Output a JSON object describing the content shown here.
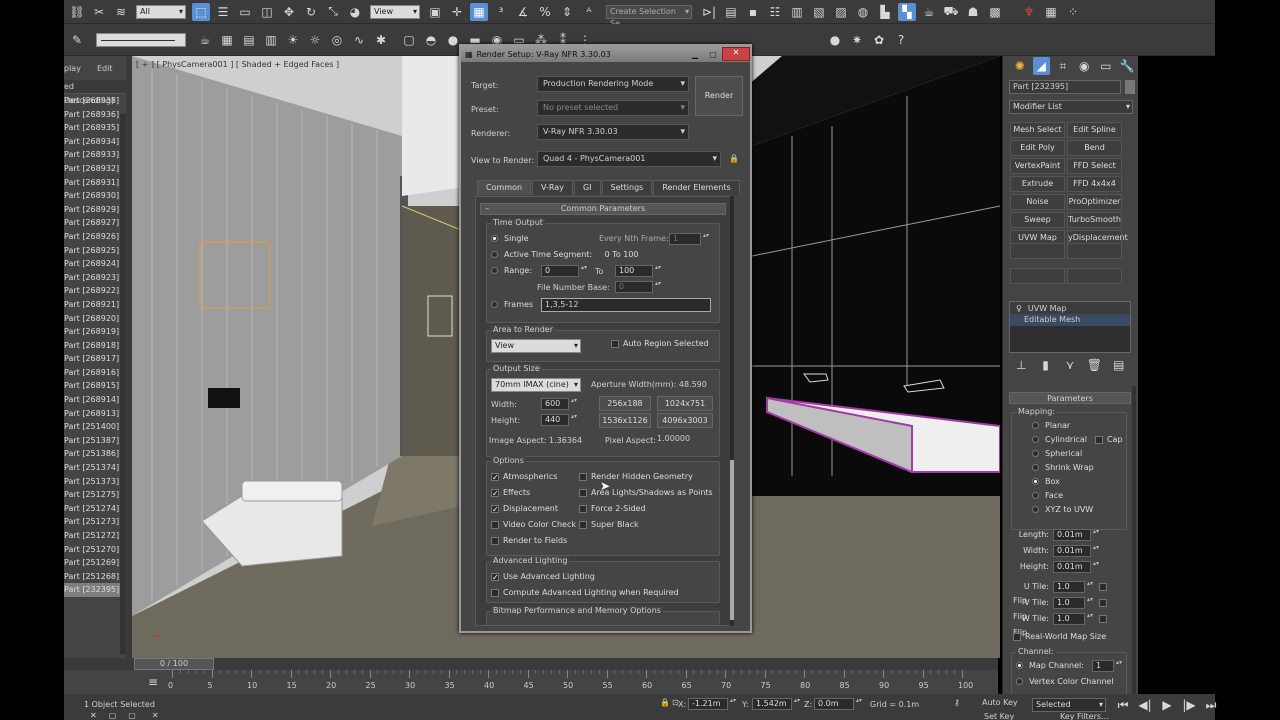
{
  "toolbar": {
    "filter_value": "All",
    "view_value": "View",
    "selection_set_placeholder": "Create Selection Se"
  },
  "scene_panel": {
    "menu": [
      "play",
      "Edit"
    ],
    "sort_label": "ed Descending)",
    "items": [
      "Part [268938]",
      "Part [268936]",
      "Part [268935]",
      "Part [268934]",
      "Part [268933]",
      "Part [268932]",
      "Part [268931]",
      "Part [268930]",
      "Part [268929]",
      "Part [268927]",
      "Part [268926]",
      "Part [268925]",
      "Part [268924]",
      "Part [268923]",
      "Part [268922]",
      "Part [268921]",
      "Part [268920]",
      "Part [268919]",
      "Part [268918]",
      "Part [268917]",
      "Part [268916]",
      "Part [268915]",
      "Part [268914]",
      "Part [268913]",
      "Part [251400]",
      "Part [251387]",
      "Part [251386]",
      "Part [251374]",
      "Part [251373]",
      "Part [251275]",
      "Part [251274]",
      "Part [251273]",
      "Part [251272]",
      "Part [251270]",
      "Part [251269]",
      "Part [251268]",
      "Part [232395]"
    ]
  },
  "viewport": {
    "label": "[ + ] [ PhysCamera001 ] [ Shaded + Edged Faces ]"
  },
  "render_setup": {
    "title": "Render Setup: V-Ray NFR 3.30.03",
    "target_label": "Target:",
    "target_value": "Production Rendering Mode",
    "preset_label": "Preset:",
    "preset_value": "No preset selected",
    "renderer_label": "Renderer:",
    "renderer_value": "V-Ray NFR 3.30.03",
    "render_button": "Render",
    "view_label": "View to Render:",
    "view_value": "Quad 4 - PhysCamera001",
    "tabs": [
      "Common",
      "V-Ray",
      "GI",
      "Settings",
      "Render Elements"
    ],
    "rollout_title": "Common Parameters",
    "time_output": {
      "title": "Time Output",
      "single": "Single",
      "every_nth": "Every Nth Frame:",
      "every_nth_value": "1",
      "active_segment": "Active Time Segment:",
      "active_segment_value": "0 To 100",
      "range": "Range:",
      "range_from": "0",
      "range_to_label": "To",
      "range_to": "100",
      "file_number_base": "File Number Base:",
      "file_number_base_value": "0",
      "frames": "Frames",
      "frames_value": "1,3,5-12"
    },
    "area_to_render": {
      "title": "Area to Render",
      "value": "View",
      "auto_region": "Auto Region Selected"
    },
    "output_size": {
      "title": "Output Size",
      "preset": "70mm IMAX (cine)",
      "aperture": "Aperture Width(mm): 48.590",
      "width_label": "Width:",
      "width_value": "600",
      "height_label": "Height:",
      "height_value": "440",
      "presets": [
        "256x188",
        "1024x751",
        "1536x1126",
        "4096x3003"
      ],
      "image_aspect": "Image Aspect: 1.36364",
      "pixel_aspect_label": "Pixel Aspect:",
      "pixel_aspect_value": "1.00000"
    },
    "options": {
      "title": "Options",
      "left": [
        {
          "label": "Atmospherics",
          "checked": true
        },
        {
          "label": "Effects",
          "checked": true
        },
        {
          "label": "Displacement",
          "checked": true
        },
        {
          "label": "Video Color Check",
          "checked": false
        },
        {
          "label": "Render to Fields",
          "checked": false
        }
      ],
      "right": [
        {
          "label": "Render Hidden Geometry",
          "checked": false
        },
        {
          "label": "Area Lights/Shadows as Points",
          "checked": false
        },
        {
          "label": "Force 2-Sided",
          "checked": false
        },
        {
          "label": "Super Black",
          "checked": false
        }
      ]
    },
    "advanced_lighting": {
      "title": "Advanced Lighting",
      "use": "Use Advanced Lighting",
      "compute": "Compute Advanced Lighting when Required"
    },
    "bitmap_title": "Bitmap Performance and Memory Options"
  },
  "command_panel": {
    "object_name": "Part [232395]",
    "modifier_list": "Modifier List",
    "modifier_buttons": [
      "Mesh Select",
      "Edit Spline",
      "Edit Poly",
      "Bend",
      "VertexPaint",
      "FFD Select",
      "Extrude",
      "FFD 4x4x4",
      "Noise",
      "ProOptimizer",
      "Sweep",
      "TurboSmooth",
      "UVW Map",
      "yDisplacement"
    ],
    "stack": [
      "UVW Map",
      "Editable Mesh"
    ],
    "parameters_title": "Parameters",
    "mapping_title": "Mapping:",
    "mappings": [
      "Planar",
      "Cylindrical",
      "Spherical",
      "Shrink Wrap",
      "Box",
      "Face",
      "XYZ to UVW"
    ],
    "cap_label": "Cap",
    "dimensions": [
      {
        "label": "Length:",
        "value": "0.01m"
      },
      {
        "label": "Width:",
        "value": "0.01m"
      },
      {
        "label": "Height:",
        "value": "0.01m"
      }
    ],
    "tiles": [
      {
        "label": "U Tile:",
        "value": "1.0"
      },
      {
        "label": "V Tile:",
        "value": "1.0"
      },
      {
        "label": "W Tile:",
        "value": "1.0"
      }
    ],
    "flip_label": "Flip",
    "real_world": "Real-World Map Size",
    "channel_title": "Channel:",
    "map_channel_label": "Map Channel:",
    "map_channel_value": "1",
    "vertex_color": "Vertex Color Channel"
  },
  "timeline": {
    "frame_counter": "0 / 100",
    "ticks": [
      "0",
      "5",
      "10",
      "15",
      "20",
      "25",
      "30",
      "35",
      "40",
      "45",
      "50",
      "55",
      "60",
      "65",
      "70",
      "75",
      "80",
      "85",
      "90",
      "95",
      "100"
    ]
  },
  "status": {
    "selection": "1 Object Selected",
    "x_label": "X:",
    "x_value": "-1.21m",
    "y_label": "Y:",
    "y_value": "1.542m",
    "z_label": "Z:",
    "z_value": "0.0m",
    "grid": "Grid = 0.1m",
    "auto_key": "Auto Key",
    "auto_key_value": "Selected",
    "set_key": "Set Key",
    "key_filters": "Key Filters..."
  }
}
